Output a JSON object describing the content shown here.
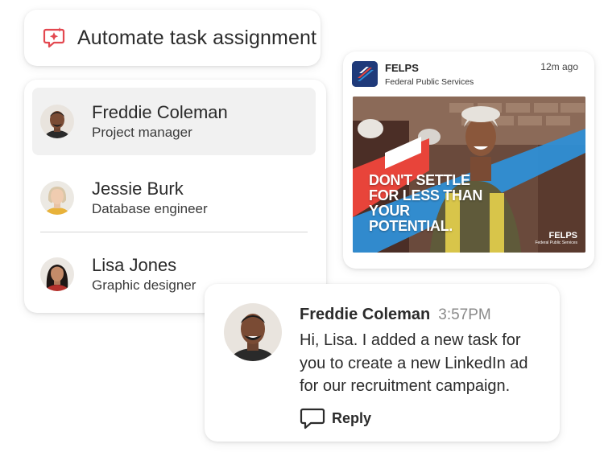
{
  "header": {
    "title": "Automate task assignment",
    "icon": "sparkle-chat-icon",
    "accent": "#e34850"
  },
  "people": [
    {
      "name": "Freddie Coleman",
      "role": "Project manager",
      "selected": true,
      "icon": "avatar-freddie"
    },
    {
      "name": "Jessie Burk",
      "role": "Database engineer",
      "selected": false,
      "icon": "avatar-jessie"
    },
    {
      "name": "Lisa Jones",
      "role": "Graphic designer",
      "selected": false,
      "icon": "avatar-lisa"
    }
  ],
  "post": {
    "org_name": "FELPS",
    "org_full": "Federal Public Services",
    "time": "12m ago",
    "ad": {
      "headline_lines": [
        "DON'T SETTLE",
        "FOR LESS THAN",
        "YOUR",
        "POTENTIAL."
      ],
      "brand": "FELPS",
      "brand_sub": "Federal Public Services"
    }
  },
  "message": {
    "sender": "Freddie Coleman",
    "time": "3:57PM",
    "body": "Hi, Lisa. I added a new task for you to create a new LinkedIn ad for our recruitment campaign.",
    "reply_label": "Reply"
  },
  "colors": {
    "logo_bg": "#1f3a7a",
    "ad_red": "#e8443a",
    "ad_blue": "#2f8fd6"
  }
}
